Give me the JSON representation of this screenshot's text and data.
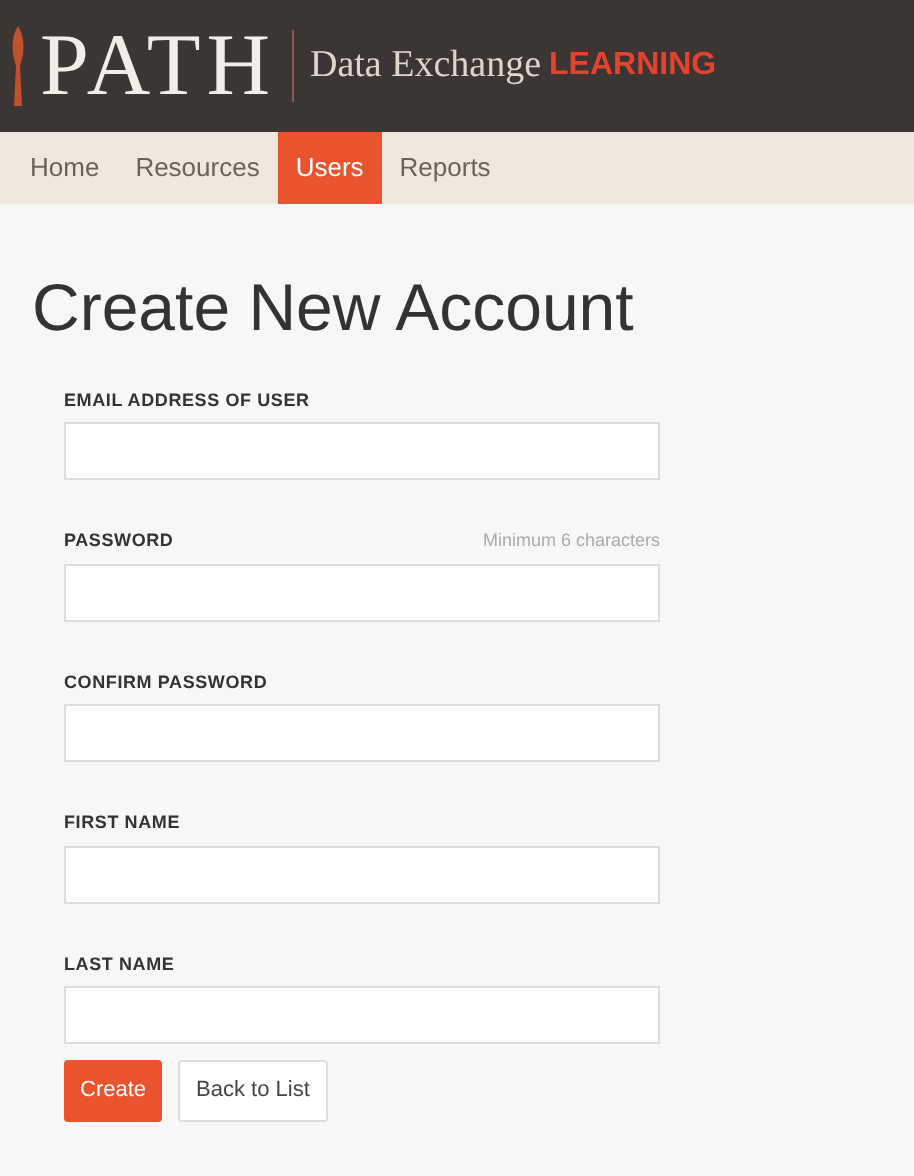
{
  "header": {
    "logo": "PATH",
    "subtitle": "Data Exchange",
    "badge": "LEARNING"
  },
  "nav": [
    {
      "label": "Home",
      "selected": false
    },
    {
      "label": "Resources",
      "selected": false
    },
    {
      "label": "Users",
      "selected": true
    },
    {
      "label": "Reports",
      "selected": false
    }
  ],
  "title": "Create New Account",
  "fields": [
    {
      "label": "EMAIL ADDRESS OF USER"
    },
    {
      "label": "PASSWORD",
      "hint": "Minimum 6 characters"
    },
    {
      "label": "CONFIRM PASSWORD"
    },
    {
      "label": "FIRST NAME"
    },
    {
      "label": "LAST NAME"
    }
  ],
  "buttons": [
    {
      "label": "Create",
      "kind": "primary"
    },
    {
      "label": "Back to List",
      "kind": "secondary"
    }
  ]
}
